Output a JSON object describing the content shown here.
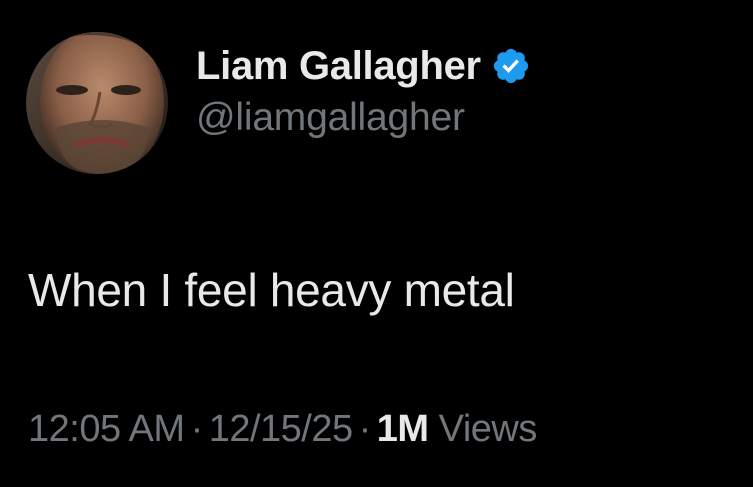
{
  "author": {
    "display_name": "Liam Gallagher",
    "handle": "@liamgallagher",
    "verified": true,
    "avatar_icon": "profile-photo-avatar",
    "badge_icon": "verified-badge-icon"
  },
  "tweet": {
    "text": "When I feel heavy metal"
  },
  "meta": {
    "time": "12:05 AM",
    "separator": "·",
    "date": "12/15/25",
    "views_count": "1M",
    "views_label": "Views"
  },
  "colors": {
    "background": "#000000",
    "primary_text": "#e7e9ea",
    "secondary_text": "#71767b",
    "verified_blue": "#1d9bf0"
  }
}
